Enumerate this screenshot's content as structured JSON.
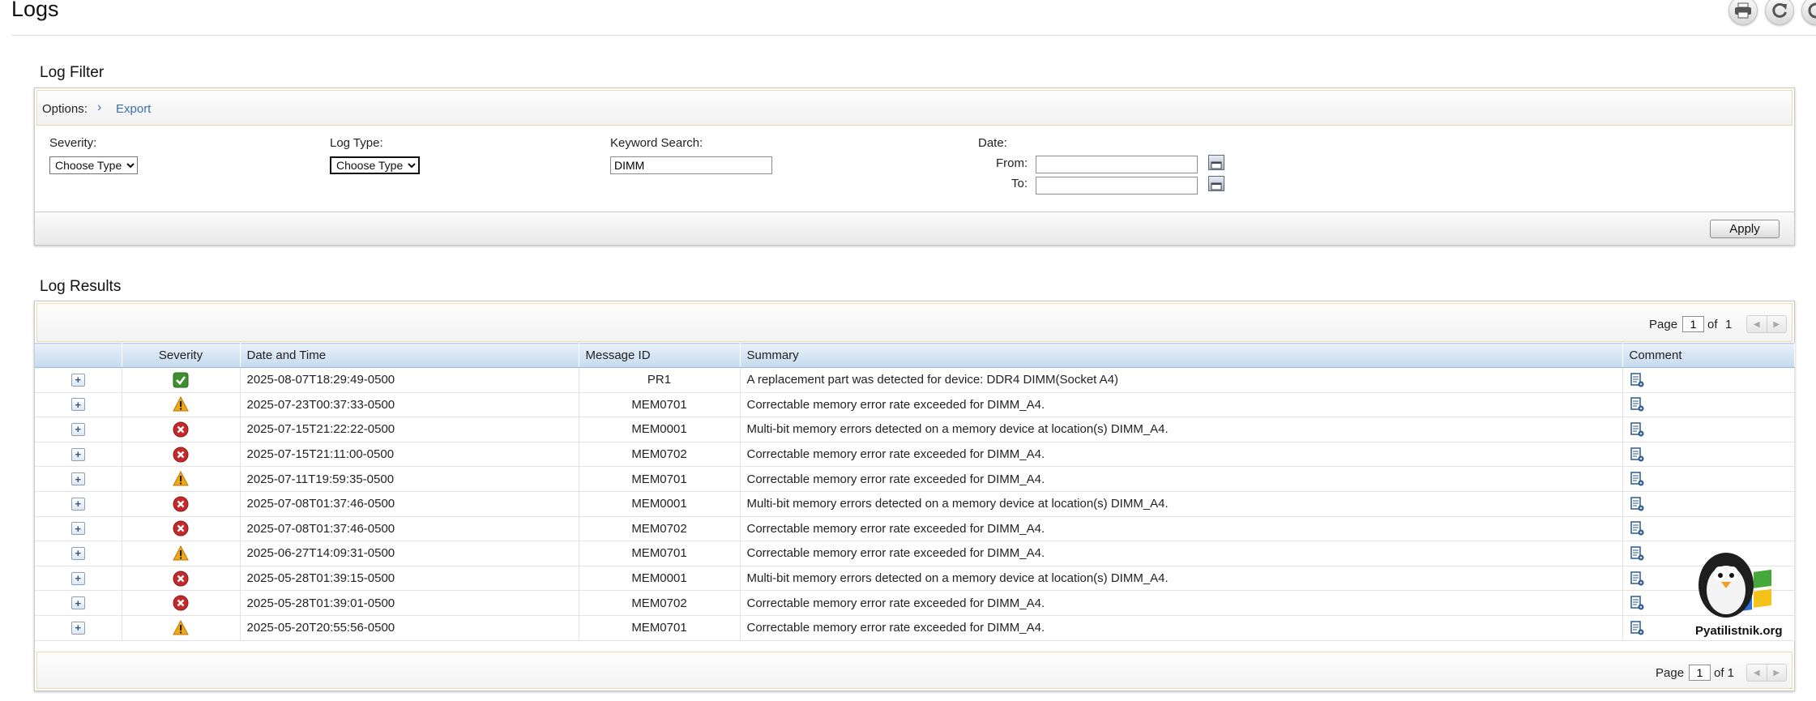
{
  "page": {
    "title": "Logs"
  },
  "toolbar": {
    "icons": [
      "print-icon",
      "refresh-icon",
      "help-icon"
    ]
  },
  "filter": {
    "section_title": "Log Filter",
    "options_label": "Options:",
    "export_label": "Export",
    "severity_label": "Severity:",
    "severity_selected": "Choose Type",
    "log_type_label": "Log Type:",
    "log_type_selected": "Choose Type",
    "keyword_label": "Keyword Search:",
    "keyword_value": "DIMM",
    "date_label": "Date:",
    "from_label": "From:",
    "to_label": "To:",
    "from_value": "",
    "to_value": "",
    "apply_label": "Apply"
  },
  "results": {
    "section_title": "Log Results",
    "pager_top": {
      "page_label": "Page",
      "current": "1",
      "of_label": "of",
      "total": "1"
    },
    "pager_bottom": {
      "page_label": "Page",
      "current": "1",
      "of_label": "of 1"
    },
    "columns": [
      "",
      "Severity",
      "Date and Time",
      "Message ID",
      "Summary",
      "Comment"
    ],
    "rows": [
      {
        "severity": "ok",
        "datetime": "2025-08-07T18:29:49-0500",
        "message_id": "PR1",
        "summary": "A replacement part was detected for device: DDR4 DIMM(Socket A4)"
      },
      {
        "severity": "warning",
        "datetime": "2025-07-23T00:37:33-0500",
        "message_id": "MEM0701",
        "summary": "Correctable memory error rate exceeded for DIMM_A4."
      },
      {
        "severity": "critical",
        "datetime": "2025-07-15T21:22:22-0500",
        "message_id": "MEM0001",
        "summary": "Multi-bit memory errors detected on a memory device at location(s) DIMM_A4."
      },
      {
        "severity": "critical",
        "datetime": "2025-07-15T21:11:00-0500",
        "message_id": "MEM0702",
        "summary": "Correctable memory error rate exceeded for DIMM_A4."
      },
      {
        "severity": "warning",
        "datetime": "2025-07-11T19:59:35-0500",
        "message_id": "MEM0701",
        "summary": "Correctable memory error rate exceeded for DIMM_A4."
      },
      {
        "severity": "critical",
        "datetime": "2025-07-08T01:37:46-0500",
        "message_id": "MEM0001",
        "summary": "Multi-bit memory errors detected on a memory device at location(s) DIMM_A4."
      },
      {
        "severity": "critical",
        "datetime": "2025-07-08T01:37:46-0500",
        "message_id": "MEM0702",
        "summary": "Correctable memory error rate exceeded for DIMM_A4."
      },
      {
        "severity": "warning",
        "datetime": "2025-06-27T14:09:31-0500",
        "message_id": "MEM0701",
        "summary": "Correctable memory error rate exceeded for DIMM_A4."
      },
      {
        "severity": "critical",
        "datetime": "2025-05-28T01:39:15-0500",
        "message_id": "MEM0001",
        "summary": "Multi-bit memory errors detected on a memory device at location(s) DIMM_A4."
      },
      {
        "severity": "critical",
        "datetime": "2025-05-28T01:39:01-0500",
        "message_id": "MEM0702",
        "summary": "Correctable memory error rate exceeded for DIMM_A4."
      },
      {
        "severity": "warning",
        "datetime": "2025-05-20T20:55:56-0500",
        "message_id": "MEM0701",
        "summary": "Correctable memory error rate exceeded for DIMM_A4."
      }
    ]
  },
  "watermark": {
    "text": "Pyatilistnik.org"
  },
  "colors": {
    "link": "#3a6fb0",
    "ok": "#3f8f2f",
    "warning": "#f0a818",
    "critical": "#c42a2a",
    "header": "#c6daee"
  }
}
